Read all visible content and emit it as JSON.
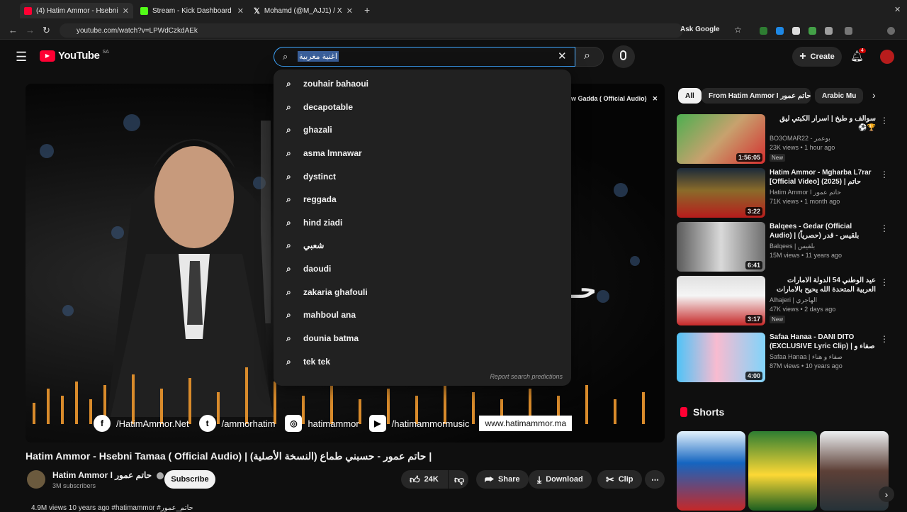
{
  "browser": {
    "tabs": [
      {
        "label": "(4) Hatim Ammor - Hsebni",
        "color": "#ff0033"
      },
      {
        "label": "Stream - Kick Dashboard",
        "color": "#53fc18"
      },
      {
        "label": "Mohamd (@M_AJJ1) / X",
        "color": "#ffffff"
      }
    ],
    "url": "youtube.com/watch?v=LPWdCzkdAEk",
    "ask_google": "Ask Google"
  },
  "header": {
    "logo": "YouTube",
    "region": "SA",
    "search_query": "اغنية مغربية",
    "create_label": "Create",
    "notification_count": "4"
  },
  "suggestions": [
    "zouhair bahaoui",
    "decapotable",
    "ghazali",
    "asma lmnawar",
    "dystinct",
    "reggada",
    "hind ziadi",
    "شعبي",
    "daoudi",
    "zakaria ghafouli",
    "mahboul ana",
    "dounia batma",
    "tek tek"
  ],
  "report_text": "Report search predictions",
  "overlay_title": "w Gadda ( Official Audio)",
  "video_socials": {
    "facebook": "/HatimAmmor.Net",
    "twitter": "/ammorhatim",
    "instagram": "hatimammor",
    "youtube": "/hatimammormusic",
    "website": "www.hatimammor.ma"
  },
  "video": {
    "title": "Hatim Ammor - Hsebni Tamaa ( Official Audio) | حاتم عمور - حسبني طماع (النسخة الأصلية) |",
    "channel": "Hatim Ammor I حاتم عمور",
    "subscribers": "3M subscribers",
    "subscribe_label": "Subscribe",
    "likes": "24K",
    "share_label": "Share",
    "download_label": "Download",
    "clip_label": "Clip",
    "views_line": "4.9M views  10 years ago  #hatimammor  #حاتم_عمور"
  },
  "chips": [
    "All",
    "From Hatim Ammor I حاتم عمور",
    "Arabic Mu"
  ],
  "recommendations": [
    {
      "title": "سوالف و طبخ | اسرار الكبتي ليق 🏆⚽",
      "channel": "BO3OMAR22 - بوعمر",
      "views": "23K views • 1 hour ago",
      "badge": "New",
      "duration": "1:56:05"
    },
    {
      "title": "Hatim Ammor - Mgharba L7rar [Official Video] (2025) | حاتم عمور -...",
      "channel": "Hatim Ammor I حاتم عمور",
      "views": "71K views • 1 month ago",
      "badge": "",
      "duration": "3:22"
    },
    {
      "title": "Balqees - Gedar (Official Audio) | بلقيس - قدر (حصرياً)",
      "channel": "Balqees | بلقيس",
      "views": "15M views • 11 years ago",
      "badge": "",
      "duration": "6:41"
    },
    {
      "title": "عيد الوطني 54 الدولة الامارات العربية المتحدة الله يحيح بالامارات",
      "channel": "Alhajeri | الهاجري",
      "views": "47K views • 2 days ago",
      "badge": "New",
      "duration": "3:17"
    },
    {
      "title": "Safaa Hanaa - DANI DITO (EXCLUSIVE Lyric Clip) | صفاء و ...",
      "channel": "Safaa Hanaa | صفاء و هناء",
      "views": "87M views • 10 years ago",
      "badge": "",
      "duration": "4:00"
    }
  ],
  "shorts_label": "Shorts",
  "colors": {
    "accent": "#3ea6ff",
    "brand": "#ff0033",
    "bg": "#0f0f0f"
  }
}
